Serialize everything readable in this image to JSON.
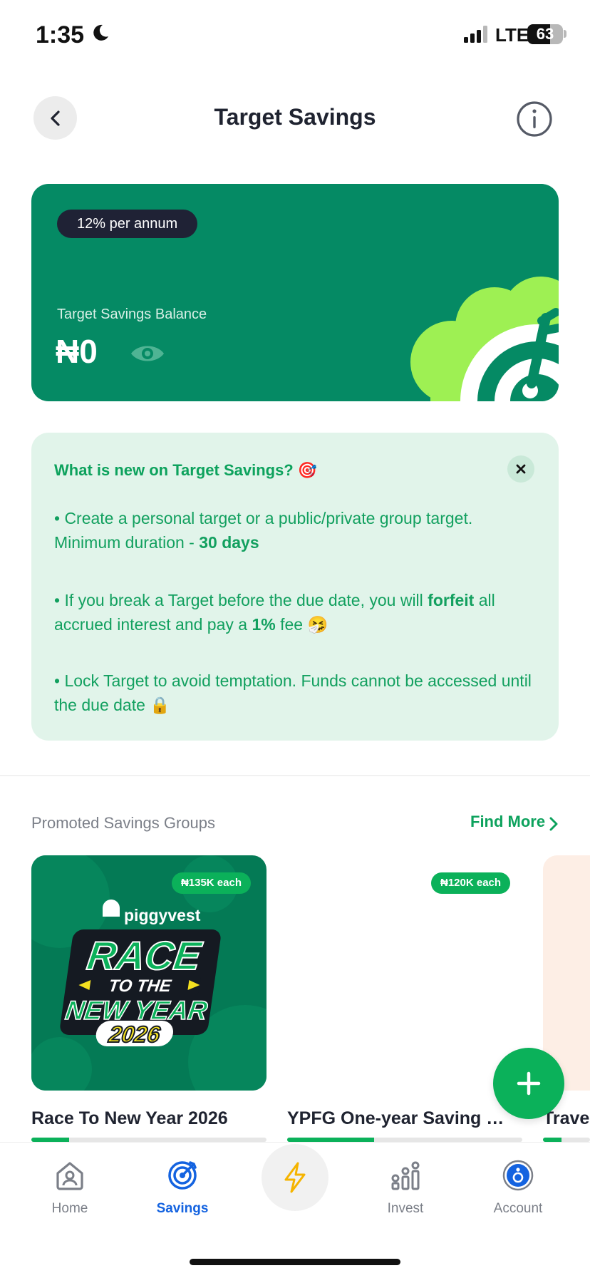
{
  "status_bar": {
    "time": "1:35",
    "network": "LTE",
    "battery": "63",
    "battery_level": 0.63
  },
  "header": {
    "title": "Target Savings"
  },
  "balance_card": {
    "rate": "12% per annum",
    "label": "Target Savings Balance",
    "amount": "₦0"
  },
  "whats_new": {
    "title": "What is new on Target Savings? 🎯",
    "bullet1": {
      "text": "• Create a personal target or a public/private group target. Minimum duration - ",
      "bold": "30 days"
    },
    "bullet2": {
      "pre": "• If you break a Target before the due date, you will ",
      "bold1": "forfeit",
      "mid": " all accrued interest and pay a ",
      "bold2": "1%",
      "post": " fee 🤧"
    },
    "bullet3": {
      "text": "• Lock Target to avoid temptation. Funds cannot be accessed until the due date 🔒"
    }
  },
  "promoted": {
    "section_label": "Promoted Savings Groups",
    "find_more": "Find More",
    "groups": [
      {
        "name": "Race To New Year 2026",
        "price": "₦135K each",
        "progress": 0.16,
        "poster": {
          "brand": "piggyvest",
          "line1": "RACE",
          "line2": "TO THE",
          "line3": "NEW YEAR",
          "line4": "2026"
        }
      },
      {
        "name": "YPFG One-year Saving Ch...",
        "price": "₦120K each",
        "progress": 0.37
      },
      {
        "name": "Travel",
        "price": "",
        "progress": 0.4
      }
    ]
  },
  "tabbar": {
    "items": [
      {
        "label": "Home",
        "icon": "home-icon"
      },
      {
        "label": "Savings",
        "icon": "target-icon",
        "active": true
      },
      {
        "label": "",
        "icon": "lightning-icon"
      },
      {
        "label": "Invest",
        "icon": "invest-icon"
      },
      {
        "label": "Account",
        "icon": "account-icon"
      }
    ]
  },
  "colors": {
    "brand_green": "#058a64",
    "accent_green": "#0bb15a",
    "tab_active": "#1463e0",
    "lime": "#9ef053"
  }
}
